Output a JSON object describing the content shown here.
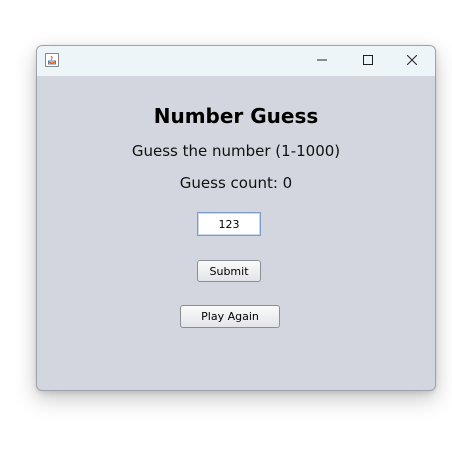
{
  "window": {
    "minimize_icon": "minimize-icon",
    "maximize_icon": "maximize-icon",
    "close_icon": "close-icon",
    "app_icon": "java-icon"
  },
  "main": {
    "title": "Number Guess",
    "instructions": "Guess the number (1-1000)",
    "guess_count": "Guess count: 0",
    "guess_value": "123",
    "submit_label": "Submit",
    "play_again_label": "Play Again"
  },
  "colors": {
    "window_bg": "#d3d6de",
    "titlebar_bg": "#eef5f9",
    "input_border": "#7a9cc6"
  }
}
